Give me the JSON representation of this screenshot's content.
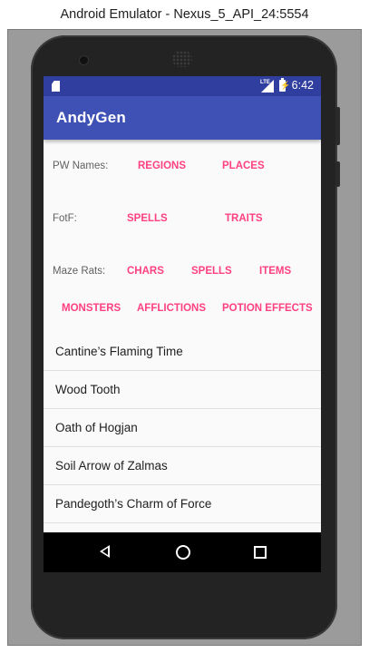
{
  "window": {
    "title": "Android Emulator - Nexus_5_API_24:5554"
  },
  "status_bar": {
    "time": "6:42",
    "network_label": "LTE"
  },
  "app_bar": {
    "title": "AndyGen"
  },
  "rows": {
    "pw": {
      "label": "PW Names:",
      "buttons": [
        "REGIONS",
        "PLACES"
      ]
    },
    "fotf": {
      "label": "FotF:",
      "buttons": [
        "SPELLS",
        "TRAITS"
      ]
    },
    "maze": {
      "label": "Maze Rats:",
      "buttons": [
        "CHARS",
        "SPELLS",
        "ITEMS"
      ]
    },
    "maze2": {
      "buttons": [
        "MONSTERS",
        "AFFLICTIONS",
        "POTION EFFECTS"
      ]
    }
  },
  "results": [
    "Cantine’s Flaming Time",
    "Wood Tooth",
    "Oath of Hogjan",
    "Soil Arrow of Zalmas",
    "Pandegoth’s Charm of Force"
  ],
  "colors": {
    "primary": "#3f51b5",
    "primary_dark": "#303f9f",
    "accent": "#ff4081"
  },
  "icons": {
    "status": [
      "sd-card-icon",
      "signal-icon",
      "battery-icon"
    ],
    "navigation": [
      "back-icon",
      "home-icon",
      "recents-icon"
    ]
  }
}
